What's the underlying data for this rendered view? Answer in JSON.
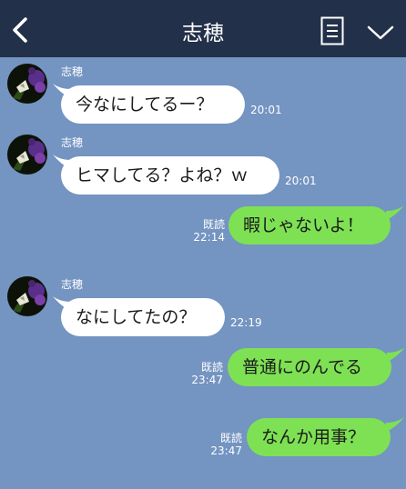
{
  "header": {
    "title": "志穂"
  },
  "messages": [
    {
      "sender": "志穂",
      "text": "今なにしてるー？",
      "time": "20:01"
    },
    {
      "sender": "志穂",
      "text": "ヒマしてる？よね？ｗ",
      "time": "20:01"
    },
    {
      "read": "既読",
      "text": "暇じゃないよ！",
      "time": "22:14"
    },
    {
      "sender": "志穂",
      "text": "なにしてたの？",
      "time": "22:19"
    },
    {
      "read": "既読",
      "text": "普通にのんでる",
      "time": "23:47"
    },
    {
      "read": "既読",
      "text": "なんか用事？",
      "time": "23:47"
    }
  ],
  "colors": {
    "background": "#7494c1",
    "header": "#23304a",
    "outgoing": "#7ee154",
    "incoming": "#ffffff"
  },
  "icons": [
    "back-icon",
    "notes-icon",
    "chevron-down-icon"
  ]
}
